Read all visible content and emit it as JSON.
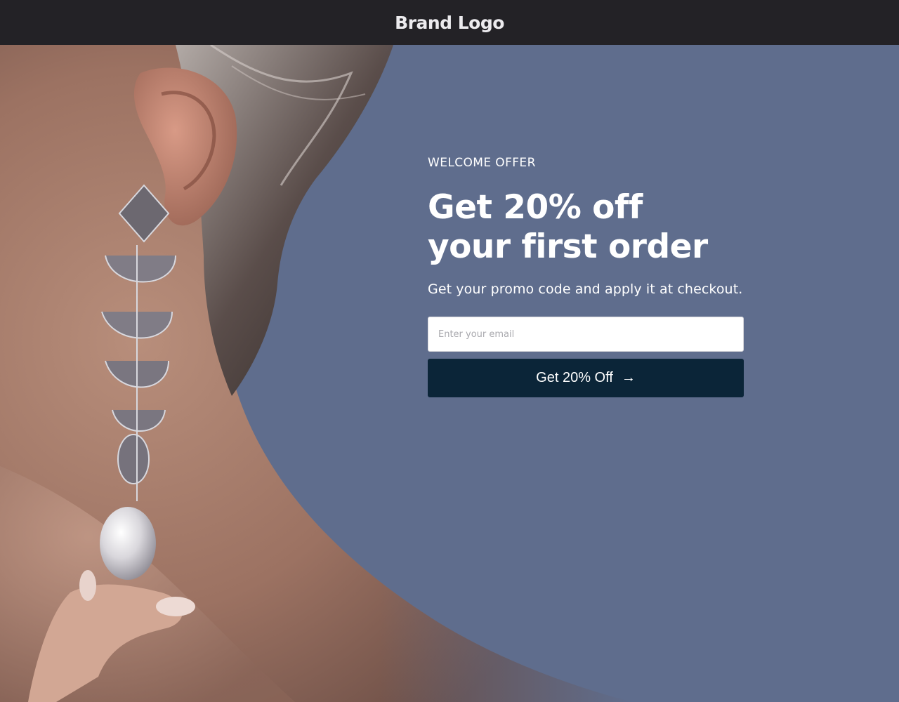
{
  "header": {
    "brand_logo": "Brand Logo"
  },
  "hero": {
    "image_description": "woman-ear-with-pearl-drop-earring",
    "eyebrow": "WELCOME OFFER",
    "headline_line1": "Get 20% off",
    "headline_line2": "your first order",
    "subtitle": "Get your promo code and apply it at checkout."
  },
  "form": {
    "email_placeholder": "Enter your email",
    "email_value": "",
    "submit_label": "Get 20% Off",
    "submit_icon": "arrow-right-icon"
  },
  "colors": {
    "topbar_bg": "#232226",
    "hero_bg": "#5f6d8d",
    "button_bg": "#0b2538",
    "text_light": "#ffffff"
  }
}
